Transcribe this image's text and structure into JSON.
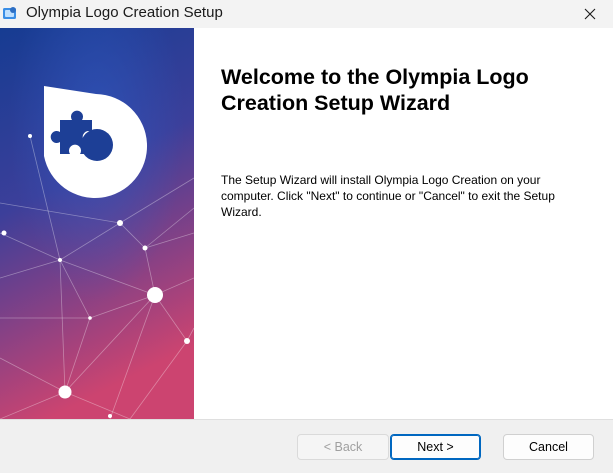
{
  "window": {
    "title": "Olympia Logo Creation Setup",
    "close_glyph": "✕"
  },
  "welcome": {
    "title": "Welcome to the Olympia Logo Creation Setup Wizard",
    "body": "The Setup Wizard will install Olympia Logo Creation on your computer.  Click \"Next\" to continue or \"Cancel\" to exit the Setup Wizard."
  },
  "buttons": {
    "back": "< Back",
    "next": "Next >",
    "cancel": "Cancel",
    "back_enabled": false
  },
  "icons": {
    "app": "installer-icon",
    "close": "close-icon",
    "banner_logo": "puzzle-logo-icon"
  },
  "colors": {
    "banner_top": "#1a3e93",
    "banner_mid": "#4b3d95",
    "banner_bottom": "#c6426e",
    "accent": "#0067c0"
  }
}
